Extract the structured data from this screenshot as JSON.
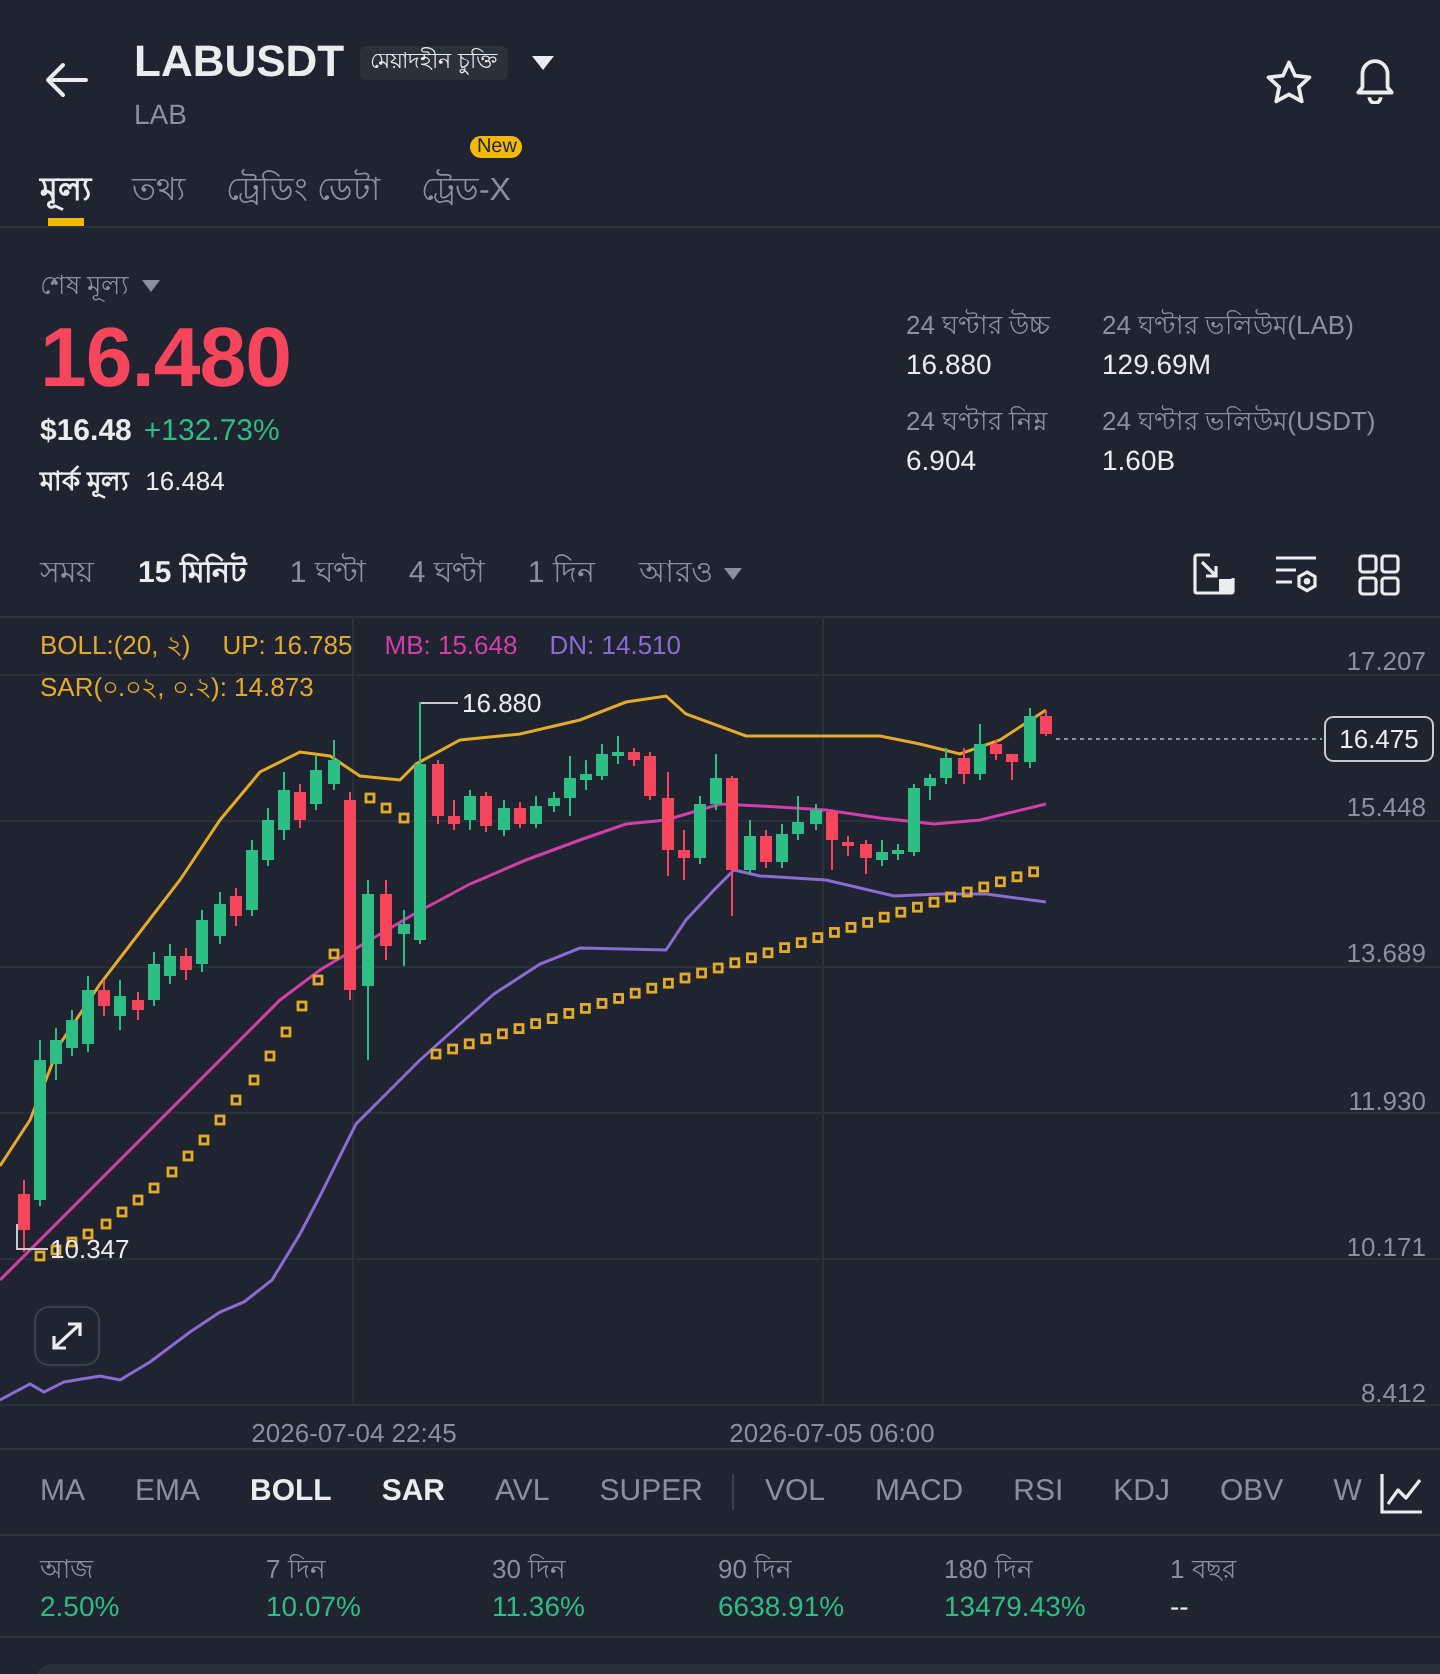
{
  "header": {
    "symbol": "LABUSDT",
    "contract_type": "মেয়াদহীন চুক্তি",
    "base_asset": "LAB"
  },
  "tabs": [
    {
      "label": "মূল্য",
      "selected": true
    },
    {
      "label": "তথ্য",
      "selected": false
    },
    {
      "label": "ট্রেডিং ডেটা",
      "selected": false
    },
    {
      "label": "ট্রেড-X",
      "selected": false,
      "badge": "New"
    }
  ],
  "price": {
    "label": "শেষ মূল্য",
    "last": "16.480",
    "last_tick_up": false,
    "usd_value": "$16.48",
    "change": "+132.73%",
    "change_positive": true,
    "mark_label": "মার্ক মূল্য",
    "mark": "16.484"
  },
  "stats": [
    {
      "label": "24 ঘণ্টার উচ্চ",
      "value": "16.880"
    },
    {
      "label": "24 ঘণ্টার ভলিউম(LAB)",
      "value": "129.69M"
    },
    {
      "label": "24 ঘণ্টার নিম্ন",
      "value": "6.904"
    },
    {
      "label": "24 ঘণ্টার ভলিউম(USDT)",
      "value": "1.60B"
    }
  ],
  "interval_bar": {
    "options": [
      {
        "label": "সময়",
        "selected": false
      },
      {
        "label": "15 মিনিট",
        "selected": true
      },
      {
        "label": "1 ঘণ্টা",
        "selected": false
      },
      {
        "label": "4 ঘণ্টা",
        "selected": false
      },
      {
        "label": "1 দিন",
        "selected": false
      }
    ],
    "more": "আরও"
  },
  "chart": {
    "legend_rows": [
      {
        "items": [
          {
            "text": "BOLL:(20, ২)",
            "color": "#e3aa2b"
          },
          {
            "text": "UP: 16.785",
            "color": "#e3aa2b"
          },
          {
            "text": "MB: 15.648",
            "color": "#d23fab"
          },
          {
            "text": "DN: 14.510",
            "color": "#8a6cd4"
          }
        ]
      },
      {
        "items": [
          {
            "text": "SAR(০.০২, ০.২): 14.873",
            "color": "#e3aa2b"
          }
        ]
      }
    ],
    "price_axis": [
      "17.207",
      "15.448",
      "13.689",
      "11.930",
      "10.171",
      "8.412"
    ],
    "time_axis": [
      "2026-07-04 22:45",
      "2026-07-05 06:00"
    ],
    "high_label": "16.880",
    "low_label": "10.347",
    "last_price_tag": "16.475"
  },
  "main_indicators": [
    {
      "label": "MA",
      "active": false
    },
    {
      "label": "EMA",
      "active": false
    },
    {
      "label": "BOLL",
      "active": true
    },
    {
      "label": "SAR",
      "active": true
    },
    {
      "label": "AVL",
      "active": false
    },
    {
      "label": "SUPER",
      "active": false
    }
  ],
  "sub_indicators": [
    {
      "label": "VOL",
      "active": false
    },
    {
      "label": "MACD",
      "active": false
    },
    {
      "label": "RSI",
      "active": false
    },
    {
      "label": "KDJ",
      "active": false
    },
    {
      "label": "OBV",
      "active": false
    },
    {
      "label": "W",
      "active": false
    }
  ],
  "performance": [
    {
      "period": "আজ",
      "value": "2.50%",
      "positive": true
    },
    {
      "period": "7 দিন",
      "value": "10.07%",
      "positive": true
    },
    {
      "period": "30 দিন",
      "value": "11.36%",
      "positive": true
    },
    {
      "period": "90 দিন",
      "value": "6638.91%",
      "positive": true
    },
    {
      "period": "180 দিন",
      "value": "13479.43%",
      "positive": true
    },
    {
      "period": "1 বছর",
      "value": "--",
      "positive": false
    }
  ]
}
